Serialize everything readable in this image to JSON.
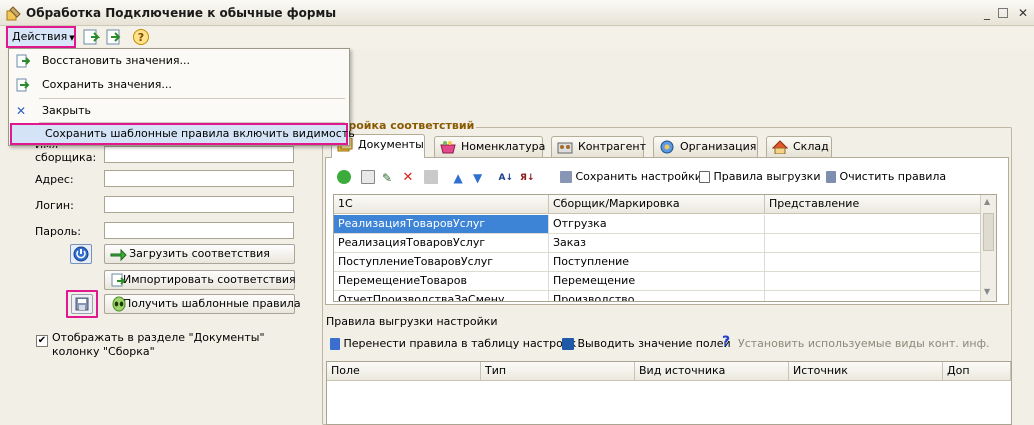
{
  "window": {
    "title": "Обработка  Подключение к обычные формы"
  },
  "toolbar": {
    "actions_label": "Действия",
    "help_icon": "question-icon"
  },
  "menu": {
    "items": [
      {
        "label": "Восстановить значения..."
      },
      {
        "label": "Сохранить значения..."
      },
      {
        "label": "Закрыть"
      },
      {
        "label": "Сохранить шаблонные правила включить видимость"
      }
    ]
  },
  "form": {
    "collector_name_label_line1": "Имя",
    "collector_name_label_line2": "сборщика:",
    "address_label": "Адрес:",
    "login_label": "Логин:",
    "password_label": "Пароль:",
    "load_button": "Загрузить соответствия",
    "import_button": "Импортировать соответствия",
    "get_templates_button": "Получить шаблонные правила",
    "show_checkbox_line1": "Отображать в разделе \"Документы\"",
    "show_checkbox_line2": "колонку \"Сборка\"",
    "show_checkbox_checked": true
  },
  "group": {
    "title": "тройка соответствий",
    "tabs": [
      {
        "label": "Документы",
        "active": true
      },
      {
        "label": "Номенклатура"
      },
      {
        "label": "Контрагент"
      },
      {
        "label": "Организация"
      },
      {
        "label": "Склад"
      }
    ],
    "toolbar": {
      "save_settings": "Сохранить настройки",
      "export_rules": "Правила выгрузки",
      "clear_rules": "Очистить правила"
    },
    "grid": {
      "columns": [
        "1С",
        "Сборщик/Маркировка",
        "Представление"
      ],
      "rows": [
        [
          "РеализацияТоваровУслуг",
          "Отгрузка",
          ""
        ],
        [
          "РеализацияТоваровУслуг",
          "Заказ",
          ""
        ],
        [
          "ПоступлениеТоваровУслуг",
          "Поступление",
          ""
        ],
        [
          "ПеремещениеТоваров",
          "Перемещение",
          ""
        ],
        [
          "ОтчетПроизводстваЗаСмену",
          "Производство",
          ""
        ]
      ]
    }
  },
  "lower": {
    "title": "Правила выгрузки настройки",
    "transfer_rules": "Перенести правила в таблицу настроек",
    "output_values": "Выводить значение полей",
    "set_contact_types": "Установить используемые виды конт. инф.",
    "columns": [
      "Поле",
      "Тип",
      "Вид источника",
      "Источник",
      "Доп"
    ]
  }
}
